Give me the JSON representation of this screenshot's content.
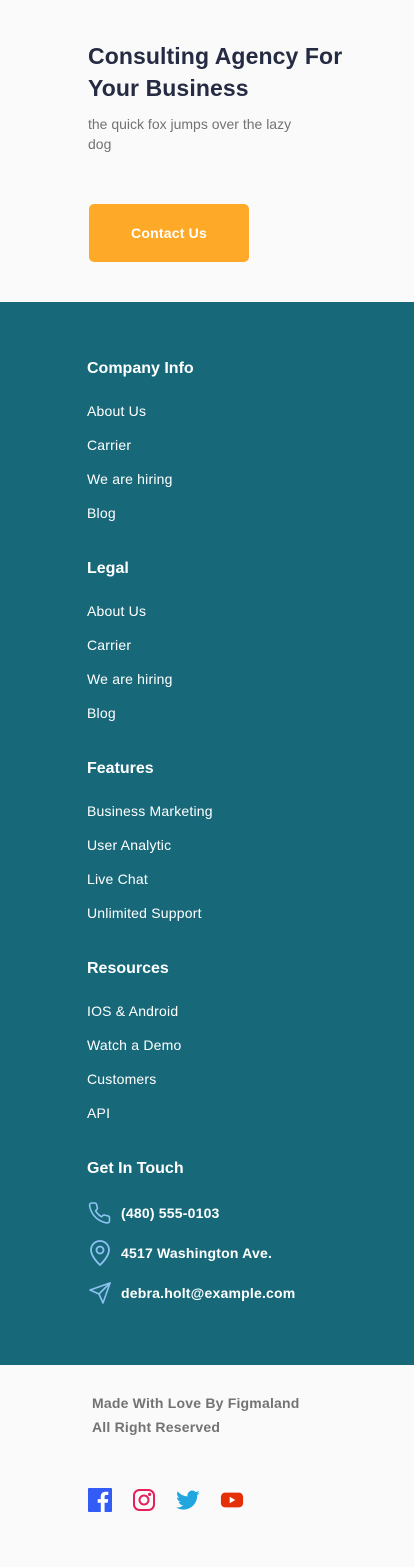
{
  "hero": {
    "title": "Consulting Agency For Your Business",
    "subtitle": "the quick fox jumps over the lazy dog",
    "cta_label": "Contact Us"
  },
  "footer": {
    "columns": [
      {
        "title": "Company Info",
        "items": [
          "About Us",
          "Carrier",
          "We are hiring",
          "Blog"
        ]
      },
      {
        "title": "Legal",
        "items": [
          "About Us",
          "Carrier",
          "We are hiring",
          "Blog"
        ]
      },
      {
        "title": "Features",
        "items": [
          "Business Marketing",
          "User Analytic",
          "Live Chat",
          "Unlimited Support"
        ]
      },
      {
        "title": "Resources",
        "items": [
          "IOS & Android",
          "Watch a Demo",
          "Customers",
          "API"
        ]
      }
    ],
    "contact": {
      "title": "Get In Touch",
      "phone": "(480) 555-0103",
      "address": "4517 Washington Ave.",
      "email": "debra.holt@example.com",
      "icons": [
        "phone-icon",
        "location-pin-icon",
        "send-icon"
      ]
    }
  },
  "bottom": {
    "credit_line1": "Made With Love By Figmaland",
    "credit_line2": "All Right Reserved",
    "socials": [
      "facebook-icon",
      "instagram-icon",
      "twitter-icon",
      "youtube-icon"
    ]
  },
  "colors": {
    "heading": "#252b42",
    "muted": "#737373",
    "accent": "#ffa928",
    "footer_bg": "#17697a",
    "icon_blue": "#8ec2f2"
  }
}
